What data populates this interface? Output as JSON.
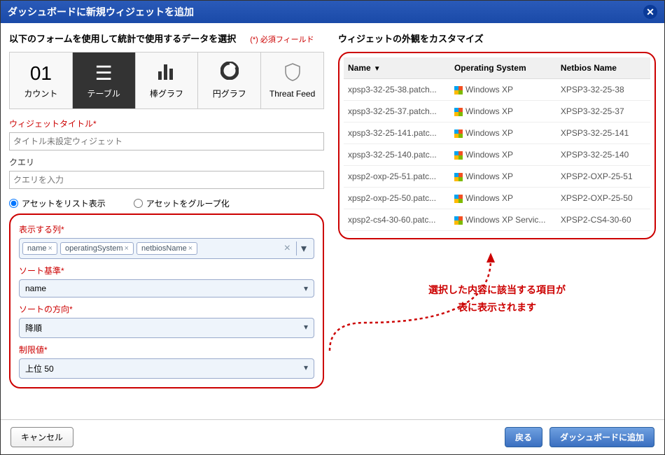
{
  "title": "ダッシュボードに新規ウィジェットを追加",
  "left_header": "以下のフォームを使用して統計で使用するデータを選択",
  "required_note": "(*) 必須フィールド",
  "right_header": "ウィジェットの外観をカスタマイズ",
  "tabs": {
    "count_icon": "01",
    "count": "カウント",
    "table": "テーブル",
    "bar": "棒グラフ",
    "pie": "円グラフ",
    "feed": "Threat Feed"
  },
  "labels": {
    "widget_title": "ウィジェットタイトル*",
    "query": "クエリ",
    "columns": "表示する列*",
    "sort_by": "ソート基準*",
    "sort_dir": "ソートの方向*",
    "limit": "制限値*"
  },
  "placeholders": {
    "title": "タイトル未設定ウィジェット",
    "query": "クエリを入力"
  },
  "radios": {
    "list": "アセットをリスト表示",
    "group": "アセットをグループ化"
  },
  "tokens": [
    "name",
    "operatingSystem",
    "netbiosName"
  ],
  "sort_by_value": "name",
  "sort_dir_value": "降順",
  "limit_value": "上位 50",
  "table_headers": {
    "name": "Name",
    "os": "Operating System",
    "nb": "Netbios Name"
  },
  "rows": [
    {
      "name": "xpsp3-32-25-38.patch...",
      "os": "Windows XP",
      "nb": "XPSP3-32-25-38"
    },
    {
      "name": "xpsp3-32-25-37.patch...",
      "os": "Windows XP",
      "nb": "XPSP3-32-25-37"
    },
    {
      "name": "xpsp3-32-25-141.patc...",
      "os": "Windows XP",
      "nb": "XPSP3-32-25-141"
    },
    {
      "name": "xpsp3-32-25-140.patc...",
      "os": "Windows XP",
      "nb": "XPSP3-32-25-140"
    },
    {
      "name": "xpsp2-oxp-25-51.patc...",
      "os": "Windows XP",
      "nb": "XPSP2-OXP-25-51"
    },
    {
      "name": "xpsp2-oxp-25-50.patc...",
      "os": "Windows XP",
      "nb": "XPSP2-OXP-25-50"
    },
    {
      "name": "xpsp2-cs4-30-60.patc...",
      "os": "Windows XP Servic...",
      "nb": "XPSP2-CS4-30-60"
    }
  ],
  "annotation_l1": "選択した内容に該当する項目が",
  "annotation_l2": "表に表示されます",
  "buttons": {
    "cancel": "キャンセル",
    "back": "戻る",
    "add": "ダッシュボードに追加"
  }
}
